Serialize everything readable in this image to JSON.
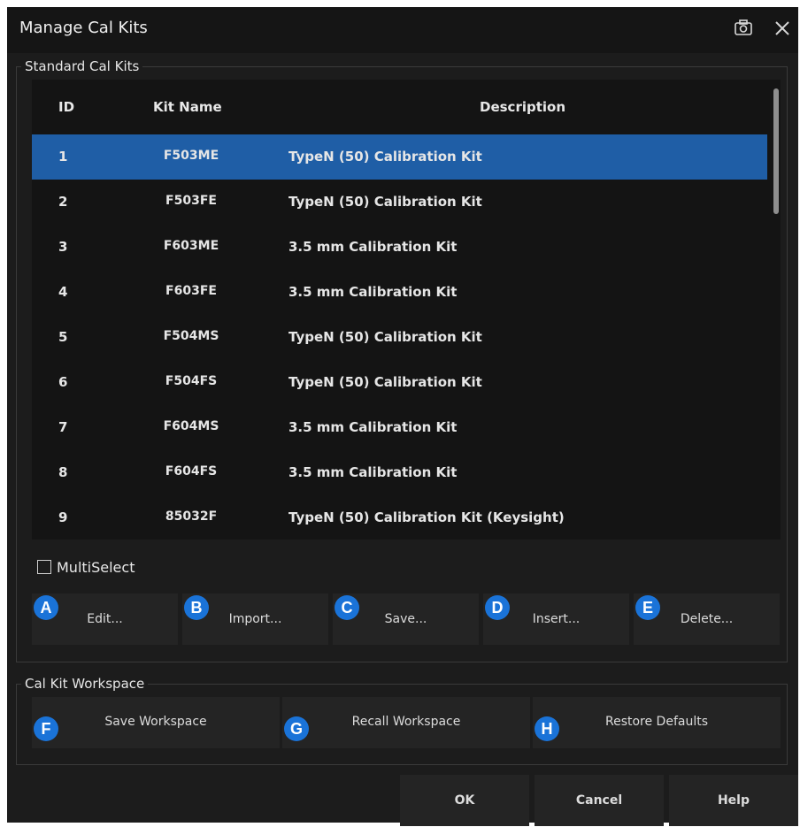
{
  "window": {
    "title": "Manage Cal Kits"
  },
  "standard_group": {
    "label": "Standard Cal Kits"
  },
  "table": {
    "headers": {
      "id": "ID",
      "name": "Kit Name",
      "description": "Description"
    },
    "selected_id": "1",
    "rows": [
      {
        "id": "1",
        "name": "F503ME",
        "description": "TypeN (50) Calibration Kit"
      },
      {
        "id": "2",
        "name": "F503FE",
        "description": "TypeN (50) Calibration Kit"
      },
      {
        "id": "3",
        "name": "F603ME",
        "description": "3.5 mm Calibration Kit"
      },
      {
        "id": "4",
        "name": "F603FE",
        "description": "3.5 mm Calibration Kit"
      },
      {
        "id": "5",
        "name": "F504MS",
        "description": "TypeN (50) Calibration Kit"
      },
      {
        "id": "6",
        "name": "F504FS",
        "description": "TypeN (50) Calibration Kit"
      },
      {
        "id": "7",
        "name": "F604MS",
        "description": "3.5 mm Calibration Kit"
      },
      {
        "id": "8",
        "name": "F604FS",
        "description": "3.5 mm Calibration Kit"
      },
      {
        "id": "9",
        "name": "85032F",
        "description": "TypeN (50) Calibration Kit (Keysight)"
      }
    ]
  },
  "multiselect": {
    "label": "MultiSelect"
  },
  "kit_buttons": [
    {
      "badge": "A",
      "label": "Edit..."
    },
    {
      "badge": "B",
      "label": "Import..."
    },
    {
      "badge": "C",
      "label": "Save..."
    },
    {
      "badge": "D",
      "label": "Insert..."
    },
    {
      "badge": "E",
      "label": "Delete..."
    }
  ],
  "workspace_group": {
    "label": "Cal Kit Workspace"
  },
  "workspace_buttons": [
    {
      "badge": "F",
      "label": "Save Workspace"
    },
    {
      "badge": "G",
      "label": "Recall Workspace"
    },
    {
      "badge": "H",
      "label": "Restore Defaults"
    }
  ],
  "footer_buttons": {
    "ok": "OK",
    "cancel": "Cancel",
    "help": "Help"
  },
  "colors": {
    "selection": "#1f5ea6",
    "badge": "#1a73d8",
    "background": "#1c1c1c"
  }
}
